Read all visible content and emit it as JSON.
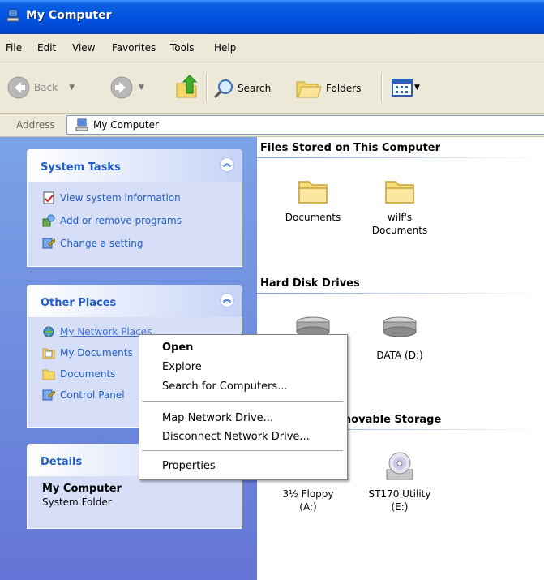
{
  "window": {
    "title": "My Computer"
  },
  "menu": [
    "File",
    "Edit",
    "View",
    "Favorites",
    "Tools",
    "Help"
  ],
  "toolbar": {
    "back": "Back",
    "search": "Search",
    "folders": "Folders"
  },
  "address": {
    "label": "Address",
    "value": "My Computer"
  },
  "system_tasks": {
    "title": "System Tasks",
    "items": [
      "View system information",
      "Add or remove programs",
      "Change a setting"
    ]
  },
  "other_places": {
    "title": "Other Places",
    "items": [
      "My Network Places",
      "My Documents",
      "Documents",
      "Control Panel"
    ]
  },
  "details": {
    "title": "Details",
    "name": "My Computer",
    "type": "System Folder"
  },
  "groups": {
    "files": {
      "title": "Files Stored on This Computer",
      "items": [
        "Documents",
        "wilf's\nDocuments"
      ]
    },
    "hdd": {
      "title": "Hard Disk Drives",
      "items": [
        "DATA (D:)"
      ]
    },
    "removable": {
      "title": "Devices with Removable Storage",
      "items": [
        "3½ Floppy\n(A:)",
        "ST170 Utility\n(E:)"
      ]
    }
  },
  "context_menu": {
    "items": [
      "Open",
      "Explore",
      "Search for Computers...",
      "Map Network Drive...",
      "Disconnect Network Drive...",
      "Properties"
    ]
  }
}
